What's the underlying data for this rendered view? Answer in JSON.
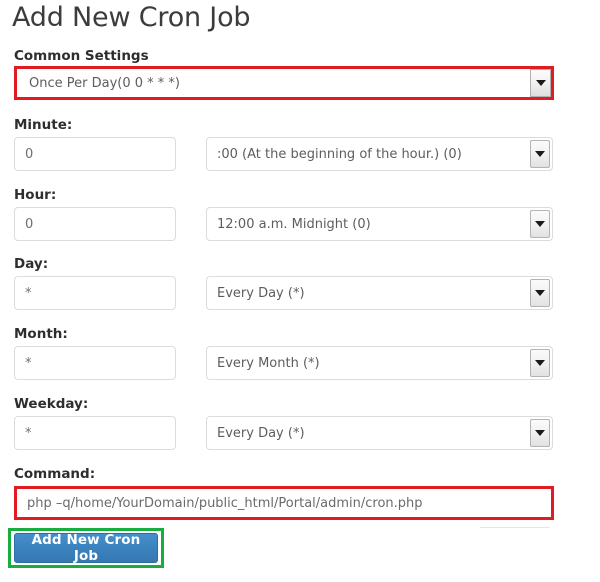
{
  "page": {
    "title": "Add New Cron Job"
  },
  "common_settings": {
    "label": "Common Settings",
    "selected": "Once Per Day(0 0 * * *)",
    "arrow_icon": "chevron-down-icon",
    "highlight_color": "#e01b22"
  },
  "fields": [
    {
      "key": "minute",
      "label": "Minute:",
      "value": "0",
      "placeholder": "",
      "select_value": ":00 (At the beginning of the hour.) (0)",
      "arrow_icon": "chevron-down-icon"
    },
    {
      "key": "hour",
      "label": "Hour:",
      "value": "0",
      "placeholder": "",
      "select_value": "12:00 a.m. Midnight (0)",
      "arrow_icon": "chevron-down-icon"
    },
    {
      "key": "day",
      "label": "Day:",
      "value": "*",
      "placeholder": "",
      "select_value": "Every Day (*)",
      "arrow_icon": "chevron-down-icon"
    },
    {
      "key": "month",
      "label": "Month:",
      "value": "*",
      "placeholder": "",
      "select_value": "Every Month (*)",
      "arrow_icon": "chevron-down-icon"
    },
    {
      "key": "weekday",
      "label": "Weekday:",
      "value": "*",
      "placeholder": "",
      "select_value": "Every Day (*)",
      "arrow_icon": "chevron-down-icon"
    }
  ],
  "command": {
    "label": "Command:",
    "value": "php –q/home/YourDomain/public_html/Portal/admin/cron.php",
    "placeholder": "",
    "highlight_color": "#e01b22"
  },
  "submit": {
    "label": "Add New Cron Job",
    "highlight_color": "#17ad3f",
    "button_color": "#3a81bd"
  }
}
